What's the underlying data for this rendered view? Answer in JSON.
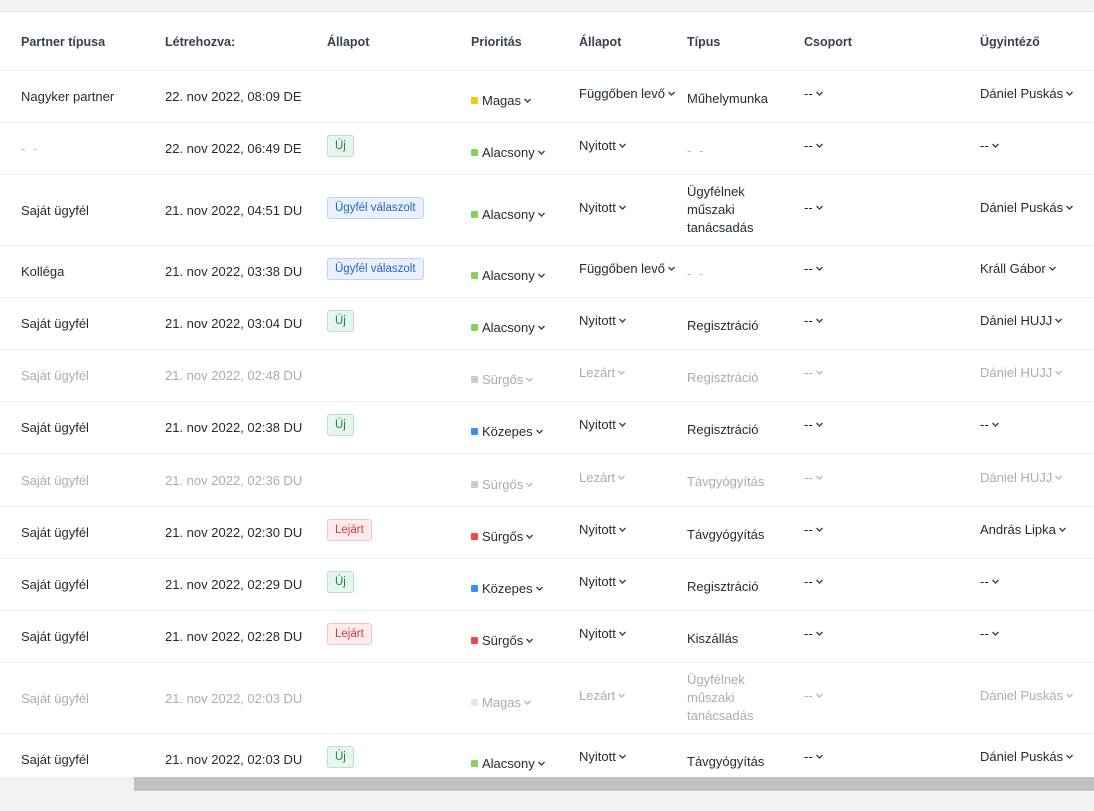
{
  "headers": [
    "Partner típusa",
    "Létrehozva:",
    "Állapot",
    "Prioritás",
    "Állapot",
    "Típus",
    "Csoport",
    "Ügyintéző"
  ],
  "colors": {
    "magas": "#f5c518",
    "alacsony": "#8bcf5b",
    "kozepes": "#3b8ff0",
    "surgos": "#f0494b",
    "faded_square": "#c9ccd1",
    "faded_magas_square": "#e4e6e9"
  },
  "rows": [
    {
      "partner": "Nagyker partner",
      "created": "22. nov 2022, 08:09 DE",
      "badge": "",
      "priority": "Magas",
      "pcolor": "#f5c518",
      "status": "Függőben levő",
      "type": "Műhelymunka",
      "group": "--",
      "agent": "Dániel Puskás"
    },
    {
      "partner": "- -",
      "created": "22. nov 2022, 06:49 DE",
      "badge": "Új",
      "priority": "Alacsony",
      "pcolor": "#8bcf5b",
      "status": "Nyitott",
      "type": "- -",
      "group": "--",
      "agent": "--"
    },
    {
      "partner": "Saját ügyfél",
      "created": "21. nov 2022, 04:51 DU",
      "badge": "Ügyfél válaszolt",
      "priority": "Alacsony",
      "pcolor": "#8bcf5b",
      "status": "Nyitott",
      "type": "Ügyfélnek műszaki tanácsadás",
      "group": "--",
      "agent": "Dániel Puskás"
    },
    {
      "partner": "Kolléga",
      "created": "21. nov 2022, 03:38 DU",
      "badge": "Ügyfél válaszolt",
      "priority": "Alacsony",
      "pcolor": "#8bcf5b",
      "status": "Függőben levő",
      "type": "- -",
      "group": "--",
      "agent": "Králl Gábor"
    },
    {
      "partner": "Saját ügyfél",
      "created": "21. nov 2022, 03:04 DU",
      "badge": "Új",
      "priority": "Alacsony",
      "pcolor": "#8bcf5b",
      "status": "Nyitott",
      "type": "Regisztráció",
      "group": "--",
      "agent": "Dániel HUJJ"
    },
    {
      "partner": "Saját ügyfél",
      "created": "21. nov 2022, 02:48 DU",
      "badge": "",
      "priority": "Sürgős",
      "pcolor": "#c9ccd1",
      "status": "Lezárt",
      "type": "Regisztráció",
      "group": "--",
      "agent": "Dániel HUJJ",
      "faded": true
    },
    {
      "partner": "Saját ügyfél",
      "created": "21. nov 2022, 02:38 DU",
      "badge": "Új",
      "priority": "Közepes",
      "pcolor": "#3b8ff0",
      "status": "Nyitott",
      "type": "Regisztráció",
      "group": "--",
      "agent": "--"
    },
    {
      "partner": "Saját ügyfél",
      "created": "21. nov 2022, 02:36 DU",
      "badge": "",
      "priority": "Sürgős",
      "pcolor": "#c9ccd1",
      "status": "Lezárt",
      "type": "Távgyógyítás",
      "group": "--",
      "agent": "Dániel HUJJ",
      "faded": true
    },
    {
      "partner": "Saját ügyfél",
      "created": "21. nov 2022, 02:30 DU",
      "badge": "Lejárt",
      "priority": "Sürgős",
      "pcolor": "#f0494b",
      "status": "Nyitott",
      "type": "Távgyógyítás",
      "group": "--",
      "agent": "András Lipka"
    },
    {
      "partner": "Saját ügyfél",
      "created": "21. nov 2022, 02:29 DU",
      "badge": "Új",
      "priority": "Közepes",
      "pcolor": "#3b8ff0",
      "status": "Nyitott",
      "type": "Regisztráció",
      "group": "--",
      "agent": "--"
    },
    {
      "partner": "Saját ügyfél",
      "created": "21. nov 2022, 02:28 DU",
      "badge": "Lejárt",
      "priority": "Sürgős",
      "pcolor": "#f0494b",
      "status": "Nyitott",
      "type": "Kiszállás",
      "group": "--",
      "agent": "--"
    },
    {
      "partner": "Saját ügyfél",
      "created": "21. nov 2022, 02:03 DU",
      "badge": "",
      "priority": "Magas",
      "pcolor": "#e4e6e9",
      "status": "Lezárt",
      "type": "Ügyfélnek műszaki tanácsadás",
      "group": "--",
      "agent": "Dániel Puskás",
      "faded": true
    },
    {
      "partner": "Saját ügyfél",
      "created": "21. nov 2022, 02:03 DU",
      "badge": "Új",
      "priority": "Alacsony",
      "pcolor": "#8bcf5b",
      "status": "Nyitott",
      "type": "Távgyógyítás",
      "group": "--",
      "agent": "Dániel Puskás"
    }
  ]
}
